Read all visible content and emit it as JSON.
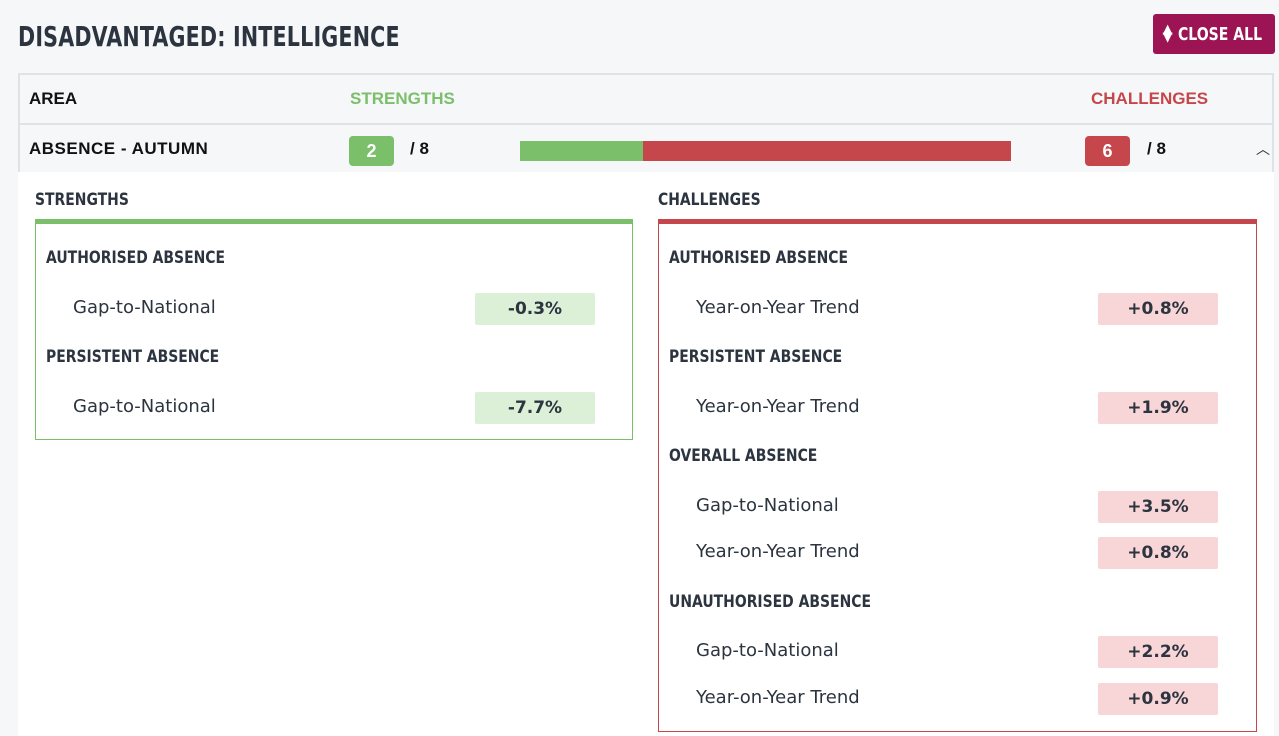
{
  "page": {
    "title": "DISADVANTAGED: INTELLIGENCE",
    "close_all_label": "CLOSE ALL"
  },
  "table": {
    "headers": {
      "area": "AREA",
      "strengths": "STRENGTHS",
      "challenges": "CHALLENGES"
    },
    "row": {
      "name": "ABSENCE - AUTUMN",
      "strengths_count": "2",
      "strengths_total": "/ 8",
      "challenges_count": "6",
      "challenges_total": "/ 8",
      "strengths_fraction": 0.25,
      "challenges_fraction": 0.75
    }
  },
  "strengths_panel": {
    "title": "STRENGTHS",
    "groups": [
      {
        "title": "AUTHORISED ABSENCE",
        "metrics": [
          {
            "label": "Gap-to-National",
            "value": "-0.3%"
          }
        ]
      },
      {
        "title": "PERSISTENT ABSENCE",
        "metrics": [
          {
            "label": "Gap-to-National",
            "value": "-7.7%"
          }
        ]
      }
    ]
  },
  "challenges_panel": {
    "title": "CHALLENGES",
    "groups": [
      {
        "title": "AUTHORISED ABSENCE",
        "metrics": [
          {
            "label": "Year-on-Year Trend",
            "value": "+0.8%"
          }
        ]
      },
      {
        "title": "PERSISTENT ABSENCE",
        "metrics": [
          {
            "label": "Year-on-Year Trend",
            "value": "+1.9%"
          }
        ]
      },
      {
        "title": "OVERALL ABSENCE",
        "metrics": [
          {
            "label": "Gap-to-National",
            "value": "+3.5%"
          },
          {
            "label": "Year-on-Year Trend",
            "value": "+0.8%"
          }
        ]
      },
      {
        "title": "UNAUTHORISED ABSENCE",
        "metrics": [
          {
            "label": "Gap-to-National",
            "value": "+2.2%"
          },
          {
            "label": "Year-on-Year Trend",
            "value": "+0.9%"
          }
        ]
      }
    ]
  },
  "colors": {
    "accent": "#9c1454",
    "strength": "#7bbf6a",
    "challenge": "#c6474b"
  },
  "icons": {
    "close_all": "sort-arrows-icon",
    "row_toggle": "chevron-up-icon"
  }
}
